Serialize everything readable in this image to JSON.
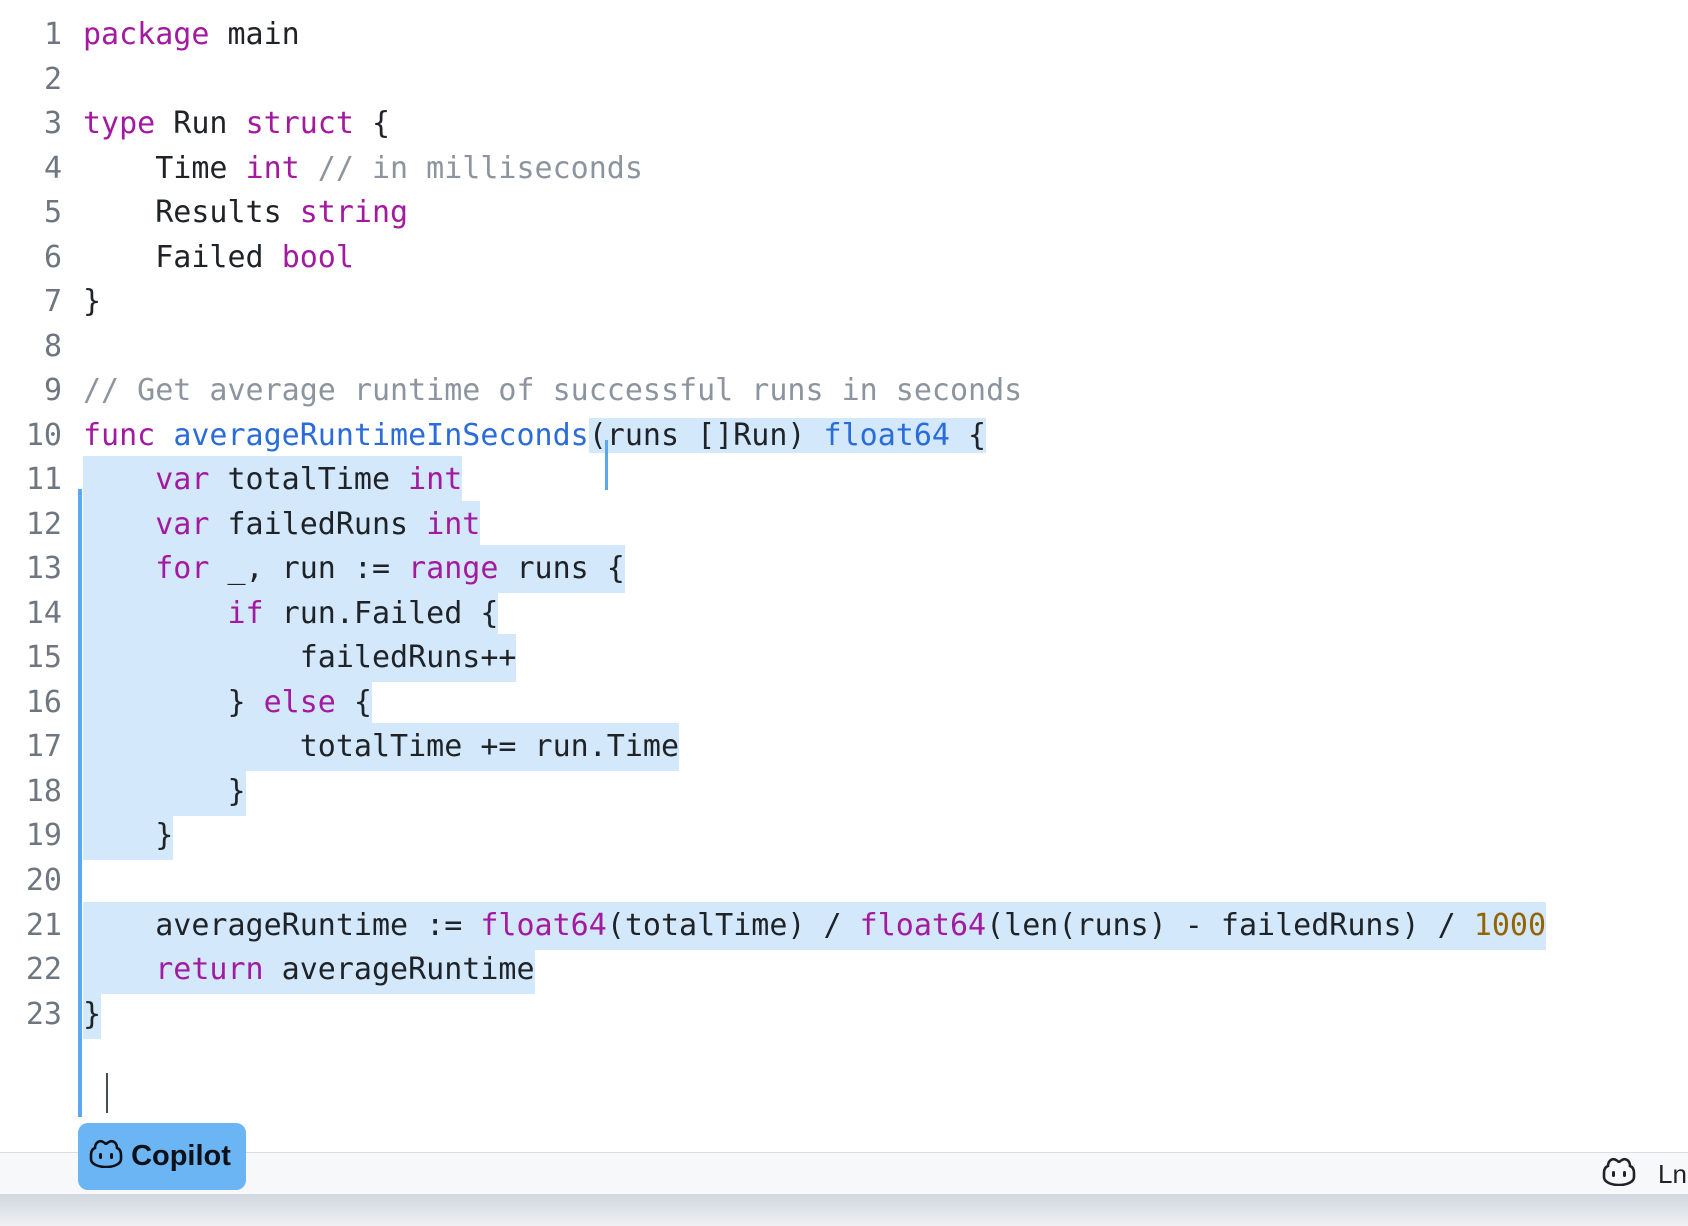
{
  "editor": {
    "language": "go",
    "lines": [
      {
        "n": "1"
      },
      {
        "n": "2"
      },
      {
        "n": "3"
      },
      {
        "n": "4"
      },
      {
        "n": "5"
      },
      {
        "n": "6"
      },
      {
        "n": "7"
      },
      {
        "n": "8"
      },
      {
        "n": "9"
      },
      {
        "n": "10"
      },
      {
        "n": "11"
      },
      {
        "n": "12"
      },
      {
        "n": "13"
      },
      {
        "n": "14"
      },
      {
        "n": "15"
      },
      {
        "n": "16"
      },
      {
        "n": "17"
      },
      {
        "n": "18"
      },
      {
        "n": "19"
      },
      {
        "n": "20"
      },
      {
        "n": "21"
      },
      {
        "n": "22"
      },
      {
        "n": "23"
      }
    ],
    "tokens": {
      "l1_kw": "package",
      "l1_txt": " main",
      "l3_kw": "type",
      "l3_txt": " Run ",
      "l3_kw2": "struct",
      "l3_txt2": " {",
      "l4_txt": "    Time ",
      "l4_kw": "int",
      "l4_cm": " // in milliseconds",
      "l5_txt": "    Results ",
      "l5_kw": "string",
      "l6_txt": "    Failed ",
      "l6_kw": "bool",
      "l7_txt": "}",
      "l9_cm": "// Get average runtime of successful runs in seconds",
      "l10_kw": "func",
      "l10_sp": " ",
      "l10_fn": "averageRuntimeInSeconds",
      "l10_txt": "(runs []Run) ",
      "l10_ty": "float64",
      "l10_txt2": " {",
      "l11_ind": "    ",
      "l11_kw": "var",
      "l11_txt": " totalTime ",
      "l11_kw2": "int",
      "l12_ind": "    ",
      "l12_kw": "var",
      "l12_txt": " failedRuns ",
      "l12_kw2": "int",
      "l13_ind": "    ",
      "l13_kw": "for",
      "l13_txt": " _, run := ",
      "l13_kw2": "range",
      "l13_txt2": " runs {",
      "l14_ind": "        ",
      "l14_kw": "if",
      "l14_txt": " run.Failed {",
      "l15_txt": "            failedRuns++",
      "l16_txt": "        } ",
      "l16_kw": "else",
      "l16_txt2": " {",
      "l17_txt": "            totalTime += run.Time",
      "l18_txt": "        }",
      "l19_txt": "    }",
      "l21_txt": "    averageRuntime := ",
      "l21_kw": "float64",
      "l21_txt2": "(totalTime) / ",
      "l21_kw2": "float64",
      "l21_txt3": "(len(runs) - failedRuns) / ",
      "l21_num": "1000",
      "l22_ind": "    ",
      "l22_kw": "return",
      "l22_txt": " averageRuntime",
      "l23_txt": "}"
    }
  },
  "copilot_button": {
    "label": "Copilot",
    "icon": "copilot-icon"
  },
  "status_bar": {
    "icon": "copilot-icon",
    "position_label": "Ln"
  },
  "colors": {
    "selection": "#d3e8fb",
    "accent": "#6bb5f5",
    "keyword": "#a31aa0",
    "function": "#2a6dd9",
    "comment": "#8c959f",
    "number": "#956400"
  }
}
